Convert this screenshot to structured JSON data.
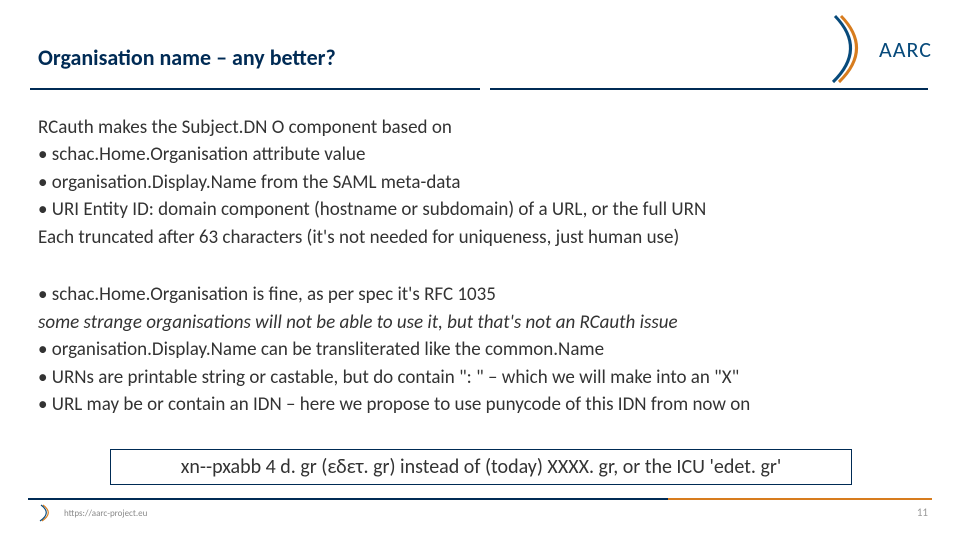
{
  "logo": {
    "text": "AARC",
    "mini_text": "AARC"
  },
  "title": "Organisation name – any better?",
  "body1": {
    "intro": "RCauth makes the Subject.DN O component based on",
    "b1": "schac.Home.Organisation attribute value",
    "b2": "organisation.Display.Name from the SAML meta-data",
    "b3": "URI Entity ID: domain component (hostname or subdomain) of a URL, or the full URN",
    "outro": "Each truncated after 63 characters (it's not needed for uniqueness, just human use)"
  },
  "body2": {
    "b1": "schac.Home.Organisation is fine, as per spec it's RFC 1035",
    "b1_sub": "some strange organisations will not be able to use it, but that's not an RCauth issue",
    "b2": "organisation.Display.Name can be transliterated like the common.Name",
    "b3": "URNs are printable string or castable, but do contain \": \" – which we will make into an \"X\"",
    "b4": "URL may be or contain an IDN – here we propose to use punycode of this IDN from now on"
  },
  "callout": "xn--pxabb 4 d. gr (εδετ. gr) instead of (today) XXXX. gr, or the ICU 'edet. gr'",
  "footer": {
    "url": "https://aarc-project.eu"
  },
  "page": "11"
}
